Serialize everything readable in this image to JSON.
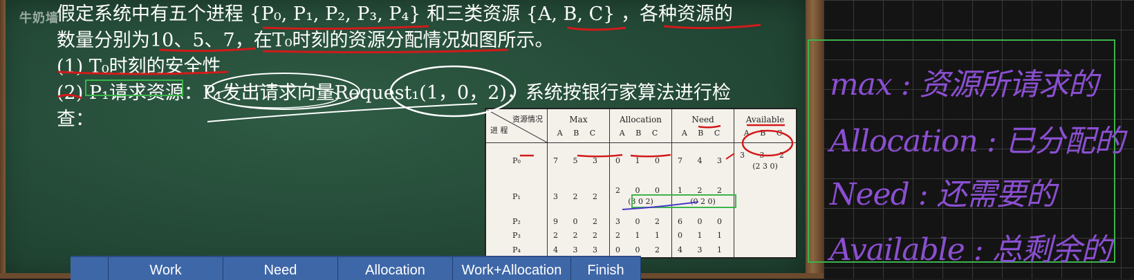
{
  "watermark": "牛奶墙",
  "problem": {
    "line1": "假定系统中有五个进程 {P₀, P₁, P₂, P₃, P₄} 和三类资源 {A, B, C} ，各种资源的",
    "line2": "数量分别为10、5、7，在T₀时刻的资源分配情况如图所示。",
    "line3": "(1) T₀时刻的安全性",
    "line4": "(2) P₁请求资源：P₁发出请求向量Request₁(1，0，2)，系统按银行家算法进行检",
    "line5": "查："
  },
  "table": {
    "corner_top": "资源情况",
    "corner_bottom": "进 程",
    "headers": [
      "Max",
      "Allocation",
      "Need",
      "Available"
    ],
    "sub": "A B C",
    "rows": [
      {
        "proc": "P₀",
        "max": "7 5 3",
        "alloc": "0 1 0",
        "need": "7 4 3",
        "avail": "3 3 2",
        "avail2": "(2 3 0)"
      },
      {
        "proc": "P₁",
        "max": "3 2 2",
        "alloc": "2 0 0",
        "alloc2": "(3 0 2)",
        "need": "1 2 2",
        "need2": "(0 2 0)",
        "avail": ""
      },
      {
        "proc": "P₂",
        "max": "9 0 2",
        "alloc": "3 0 2",
        "need": "6 0 0",
        "avail": ""
      },
      {
        "proc": "P₃",
        "max": "2 2 2",
        "alloc": "2 1 1",
        "need": "0 1 1",
        "avail": ""
      },
      {
        "proc": "P₄",
        "max": "4 3 3",
        "alloc": "0 0 2",
        "need": "4 3 1",
        "avail": ""
      }
    ]
  },
  "work_header": [
    "",
    "Work",
    "Need",
    "Allocation",
    "Work+Allocation",
    "Finish"
  ],
  "notes": [
    "max : 资源所请求的",
    "Allocation : 已分配的",
    "Need : 还需要的",
    "Available : 总剩余的"
  ],
  "colors": {
    "ink_red": "#d21a1a",
    "note_purple": "#8b4fd1",
    "highlight_green": "#3bb54a",
    "header_blue": "#3e67a8"
  }
}
